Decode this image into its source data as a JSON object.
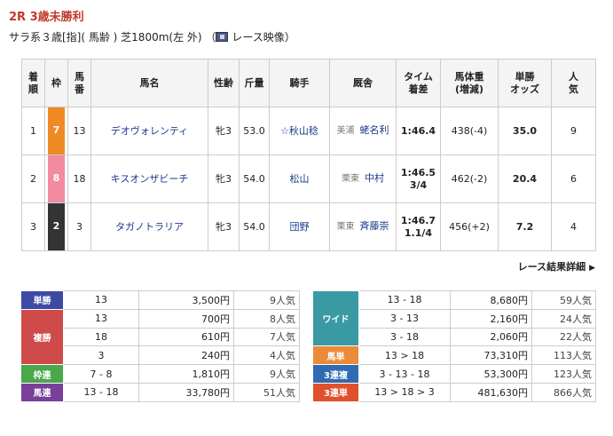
{
  "race": {
    "title": "2R 3歳未勝利",
    "info": "サラ系３歳[指](馬齢)芝1800m(左 外)",
    "info_display": "サラ系３歳[指]( 馬齢 ) 芝1800m(左 外) （",
    "video_label": "レース映像",
    "close_paren": "）"
  },
  "table": {
    "headers": {
      "rank": [
        "着",
        "順"
      ],
      "waku": "枠",
      "num": [
        "馬",
        "番"
      ],
      "horse": "馬名",
      "sexage": "性齢",
      "weight": "斤量",
      "jockey": "騎手",
      "trainer": "厩舎",
      "time": [
        "タイム",
        "着差"
      ],
      "body": [
        "馬体重",
        "(増減)"
      ],
      "odds": [
        "単勝",
        "オッズ"
      ],
      "pop": [
        "人",
        "気"
      ]
    },
    "rows": [
      {
        "rank": "1",
        "waku": "7",
        "waku_color": "#f08a24",
        "num": "13",
        "horse": "デオヴォレンティ",
        "sexage": "牝3",
        "weight": "53.0",
        "jockey": "☆秋山稔",
        "aff": "美浦",
        "trainer": "蛯名利",
        "time": "1:46.4",
        "margin": "",
        "body": "438(-4)",
        "odds": "35.0",
        "pop": "9"
      },
      {
        "rank": "2",
        "waku": "8",
        "waku_color": "#f28aa0",
        "num": "18",
        "horse": "キスオンザビーチ",
        "sexage": "牝3",
        "weight": "54.0",
        "jockey": "松山",
        "aff": "栗東",
        "trainer": "中村",
        "time": "1:46.5",
        "margin": "3/4",
        "body": "462(-2)",
        "odds": "20.4",
        "pop": "6"
      },
      {
        "rank": "3",
        "waku": "2",
        "waku_color": "#333333",
        "num": "3",
        "horse": "タガノトラリア",
        "sexage": "牝3",
        "weight": "54.0",
        "jockey": "団野",
        "aff": "栗東",
        "trainer": "斉藤崇",
        "time": "1:46.7",
        "margin": "1.1/4",
        "body": "456(+2)",
        "odds": "7.2",
        "pop": "4"
      }
    ]
  },
  "detail_link": "レース結果詳細",
  "payouts": {
    "left": [
      {
        "label": "単勝",
        "color": "#3b4aa3",
        "entries": [
          {
            "combo": "13",
            "amount": "3,500円",
            "pop": "9人気"
          }
        ]
      },
      {
        "label": "複勝",
        "color": "#cf4a4a",
        "entries": [
          {
            "combo": "13",
            "amount": "700円",
            "pop": "8人気"
          },
          {
            "combo": "18",
            "amount": "610円",
            "pop": "7人気"
          },
          {
            "combo": "3",
            "amount": "240円",
            "pop": "4人気"
          }
        ]
      },
      {
        "label": "枠連",
        "color": "#4aa84a",
        "entries": [
          {
            "combo": "7 - 8",
            "amount": "1,810円",
            "pop": "9人気"
          }
        ]
      },
      {
        "label": "馬連",
        "color": "#7a3f9a",
        "entries": [
          {
            "combo": "13 - 18",
            "amount": "33,780円",
            "pop": "51人気"
          }
        ]
      }
    ],
    "right": [
      {
        "label": "ワイド",
        "color": "#3a9aa4",
        "entries": [
          {
            "combo": "13 - 18",
            "amount": "8,680円",
            "pop": "59人気"
          },
          {
            "combo": "3 - 13",
            "amount": "2,160円",
            "pop": "24人気"
          },
          {
            "combo": "3 - 18",
            "amount": "2,060円",
            "pop": "22人気"
          }
        ]
      },
      {
        "label": "馬単",
        "color": "#ea8b3a",
        "entries": [
          {
            "combo": "13 > 18",
            "amount": "73,310円",
            "pop": "113人気"
          }
        ]
      },
      {
        "label": "3連複",
        "color": "#2f6bb3",
        "entries": [
          {
            "combo": "3 - 13 - 18",
            "amount": "53,300円",
            "pop": "123人気"
          }
        ]
      },
      {
        "label": "3連単",
        "color": "#e0502a",
        "entries": [
          {
            "combo": "13 > 18 > 3",
            "amount": "481,630円",
            "pop": "866人気"
          }
        ]
      }
    ]
  }
}
